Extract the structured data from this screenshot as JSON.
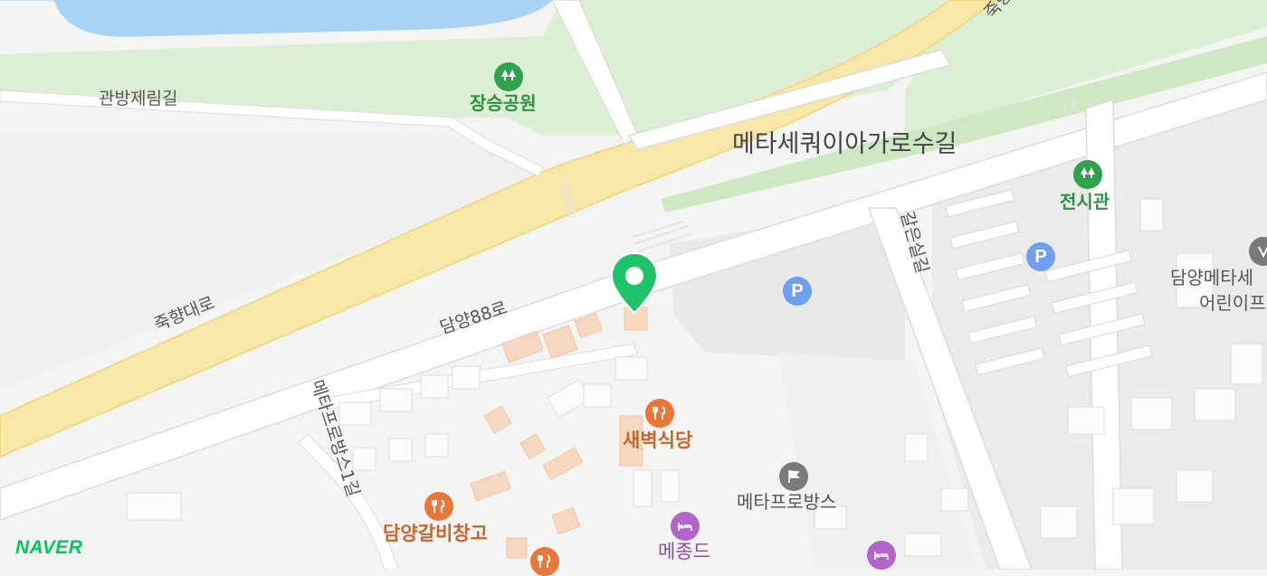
{
  "map": {
    "labels": {
      "jangseung_park": "장승공원",
      "gwanbang_road": "관방제림길",
      "metasequoia_road": "메타세쿼이아가로수길",
      "jeonsigwan": "전시관",
      "juk_hyang_road": "죽향대로",
      "damyang88": "담양88로",
      "gwaneunsil": "갈은실길",
      "metapro_road": "메타프로방스1길",
      "saebyeok": "새벽식당",
      "metaprovance": "메타프로방스",
      "galbi": "담양갈비창고",
      "mejongde": "메종드",
      "kindergarten_1": "담양메타세",
      "kindergarten_2": "어린이프",
      "top_road_partial": "죽향"
    },
    "parking_symbol": "P",
    "brand": "NAVER",
    "colors": {
      "water": "#a9d3f5",
      "park": "#d9efcf",
      "main_road": "#f8e7a6",
      "road": "#ffffff",
      "building": "#f6d7c0",
      "marker": "#1ec36a"
    }
  }
}
